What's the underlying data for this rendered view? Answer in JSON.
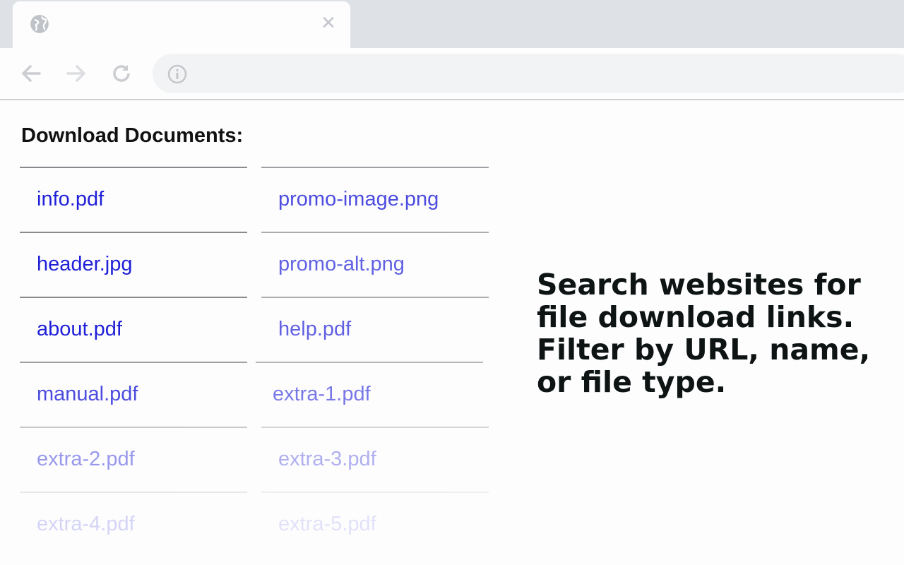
{
  "browser": {
    "tab_close_glyph": "✕",
    "icons": [
      "globe-icon",
      "close-icon",
      "back-arrow-icon",
      "forward-arrow-icon",
      "reload-icon",
      "info-icon"
    ]
  },
  "page": {
    "heading": "Download Documents:",
    "tagline": "Search websites for file download links. Filter by URL, name, or file type.",
    "links": [
      {
        "label": "info.pdf",
        "opacity": 1.0
      },
      {
        "label": "promo-image.png",
        "opacity": 0.8
      },
      {
        "label": "header.jpg",
        "opacity": 1.0
      },
      {
        "label": "promo-alt.png",
        "opacity": 0.7
      },
      {
        "label": "about.pdf",
        "opacity": 1.0
      },
      {
        "label": "help.pdf",
        "opacity": 0.7
      },
      {
        "label": "manual.pdf",
        "opacity": 0.8
      },
      {
        "label": "extra-1.pdf",
        "opacity": 0.6
      },
      {
        "label": "extra-2.pdf",
        "opacity": 0.45
      },
      {
        "label": "extra-3.pdf",
        "opacity": 0.35
      },
      {
        "label": "extra-4.pdf",
        "opacity": 0.18
      },
      {
        "label": "extra-5.pdf",
        "opacity": 0.12
      }
    ]
  },
  "colors": {
    "link": "#2020d8",
    "tab_strip": "#dee1e6",
    "omnibox": "#f1f3f4",
    "tagline": "#0d1413"
  }
}
